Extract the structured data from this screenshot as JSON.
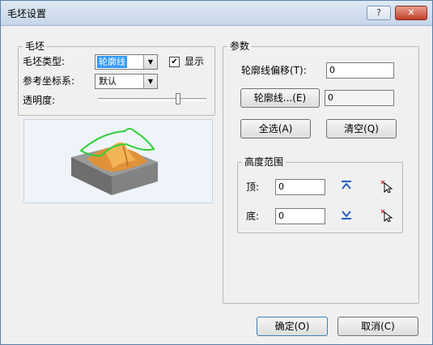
{
  "window": {
    "title": "毛坯设置",
    "help_symbol": "?",
    "close_symbol": "✕"
  },
  "blank_group": {
    "legend": "毛坯",
    "type_label": "毛坯类型:",
    "type_value": "轮廓线",
    "show_checked": true,
    "show_label": "显示",
    "coord_label": "参考坐标系:",
    "coord_value": "默认",
    "transparency_label": "透明度:",
    "transparency_level": 0.75
  },
  "params_group": {
    "legend": "参数",
    "offset_label": "轮廓线偏移(T):",
    "offset_value": "0",
    "contour_button": "轮廓线...(E)",
    "contour_value": "0",
    "select_all_button": "全选(A)",
    "clear_button": "清空(Q)",
    "height_legend": "高度范围",
    "top_label": "顶:",
    "top_value": "0",
    "bottom_label": "底:",
    "bottom_value": "0"
  },
  "footer": {
    "ok_button": "确定(O)",
    "cancel_button": "取消(C)"
  },
  "colors": {
    "selection": "#3399ff",
    "arrow_icon": "#1f5fbf",
    "pick_icon": "#cc2222"
  }
}
